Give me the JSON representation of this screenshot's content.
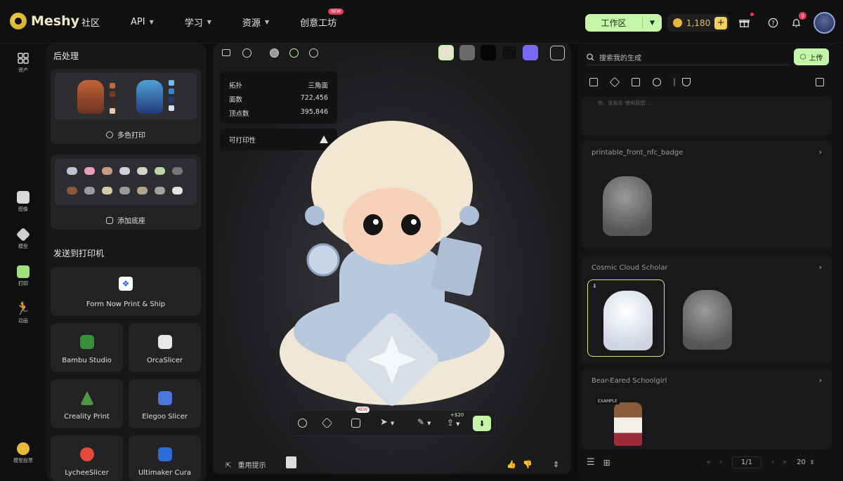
{
  "header": {
    "logo_text": "Meshy",
    "nav": [
      {
        "label": "社区",
        "has_caret": false
      },
      {
        "label": "API",
        "has_caret": true
      },
      {
        "label": "学习",
        "has_caret": true
      },
      {
        "label": "资源",
        "has_caret": true
      },
      {
        "label": "创意工坊",
        "has_caret": false
      }
    ],
    "new_tag": "NEW",
    "workspace_label": "工作区",
    "credits": "1,180",
    "notification_count": "3",
    "icons": [
      "gift-icon",
      "help-icon",
      "bell-icon"
    ]
  },
  "rail": {
    "items": [
      {
        "label": "资产"
      },
      {
        "label": "图像"
      },
      {
        "label": "模型"
      },
      {
        "label": "打印"
      },
      {
        "label": "动画"
      },
      {
        "label": "模型投票"
      }
    ]
  },
  "left_panel": {
    "post_title": "后处理",
    "multicolor_label": "多色打印",
    "add_base_label": "添加底座",
    "send_title": "发送到打印机",
    "form_now": "Form Now Print & Ship",
    "slicers": [
      {
        "name": "Bambu Studio",
        "color": "#3a8f3a"
      },
      {
        "name": "OrcaSlicer",
        "color": "#e8e8e8"
      },
      {
        "name": "Creality Print",
        "color": "#4c9a3f"
      },
      {
        "name": "Elegoo Slicer",
        "color": "#4a78d8"
      },
      {
        "name": "LycheeSlicer",
        "color": "#e34a3a"
      },
      {
        "name": "Ultimaker Cura",
        "color": "#2d6bd6"
      }
    ]
  },
  "viewport": {
    "stats": [
      {
        "label": "拓扑",
        "value": "三角面"
      },
      {
        "label": "面数",
        "value": "722,456"
      },
      {
        "label": "顶点数",
        "value": "395,846"
      }
    ],
    "printability_label": "可打印性",
    "toolbar_new": "NEW",
    "toolbar_cost": "+$20",
    "reuse_prompt": "重用提示",
    "materials": [
      "#e9e1cf",
      "#6a6a6a",
      "#050505",
      "#111111",
      "#7a6af2"
    ]
  },
  "right_panel": {
    "search_placeholder": "搜索我的生成",
    "upload_label": "上传",
    "truncated_text": "你。请关闭 '使用原图'...",
    "generations": [
      {
        "title": "printable_front_nfc_badge"
      },
      {
        "title": "Cosmic Cloud Scholar"
      },
      {
        "title": "Bear-Eared Schoolgirl"
      }
    ],
    "example_tag": "EXAMPLE",
    "pagination": "1/1",
    "page_size": "20"
  }
}
